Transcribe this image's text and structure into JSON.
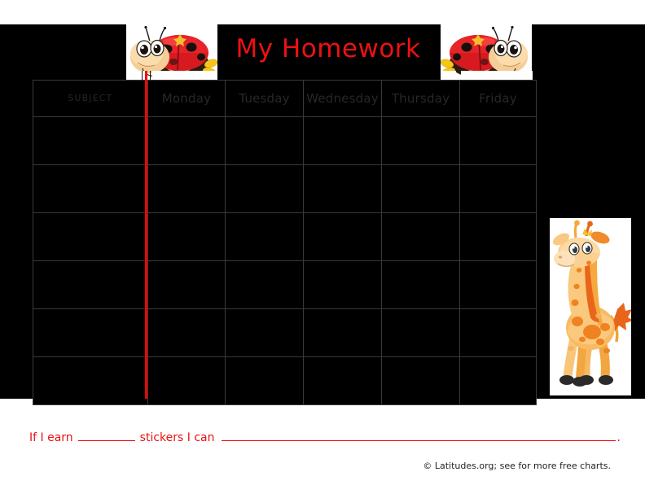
{
  "document": {
    "title": "My Homework",
    "title_color": "#ee1111"
  },
  "table": {
    "columns": [
      "SUBJECT",
      "Monday",
      "Tuesday",
      "Wednesday",
      "Thursday",
      "Friday"
    ],
    "row_count": 6,
    "cells": [
      [
        "",
        "",
        "",
        "",
        "",
        ""
      ],
      [
        "",
        "",
        "",
        "",
        "",
        ""
      ],
      [
        "",
        "",
        "",
        "",
        "",
        ""
      ],
      [
        "",
        "",
        "",
        "",
        "",
        ""
      ],
      [
        "",
        "",
        "",
        "",
        "",
        ""
      ],
      [
        "",
        "",
        "",
        "",
        "",
        ""
      ]
    ],
    "grid_line_color": "#3a3a3a",
    "background_color": "#000000",
    "header_text_color": "#272727"
  },
  "decorations": {
    "ladybug_left": "ladybug-icon",
    "ladybug_right": "ladybug-icon",
    "giraffe": "giraffe-icon",
    "margin_line_color": "#f50000"
  },
  "footer": {
    "reward_prefix": "If I earn",
    "reward_middle": "stickers I can",
    "reward_period": ".",
    "credit": "© Latitudes.org; see for more free charts."
  }
}
